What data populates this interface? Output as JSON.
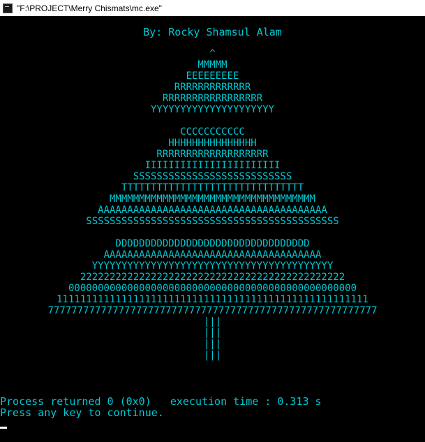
{
  "window": {
    "title": "\"F:\\PROJECT\\Merry Chismats\\mc.exe\""
  },
  "console": {
    "byline": "By: Rocky Shamsul Alam",
    "tree_lines": [
      "^",
      "MMMMM",
      "EEEEEEEEE",
      "RRRRRRRRRRRRR",
      "RRRRRRRRRRRRRRRRR",
      "YYYYYYYYYYYYYYYYYYYYY",
      "",
      "CCCCCCCCCCC",
      "HHHHHHHHHHHHHHH",
      "RRRRRRRRRRRRRRRRRRR",
      "IIIIIIIIIIIIIIIIIIIIIII",
      "SSSSSSSSSSSSSSSSSSSSSSSSSSS",
      "TTTTTTTTTTTTTTTTTTTTTTTTTTTTTTT",
      "MMMMMMMMMMMMMMMMMMMMMMMMMMMMMMMMMMM",
      "AAAAAAAAAAAAAAAAAAAAAAAAAAAAAAAAAAAAAAA",
      "SSSSSSSSSSSSSSSSSSSSSSSSSSSSSSSSSSSSSSSSSSS",
      "",
      "DDDDDDDDDDDDDDDDDDDDDDDDDDDDDDDDD",
      "AAAAAAAAAAAAAAAAAAAAAAAAAAAAAAAAAAAAA",
      "YYYYYYYYYYYYYYYYYYYYYYYYYYYYYYYYYYYYYYYYY",
      "222222222222222222222222222222222222222222222",
      "0000000000000000000000000000000000000000000000000",
      "11111111111111111111111111111111111111111111111111111",
      "77777777777777777777777777777777777777777777777777777777",
      "|||",
      "|||",
      "|||",
      "|||"
    ],
    "status_line": "Process returned 0 (0x0)   execution time : 0.313 s",
    "prompt_line": "Press any key to continue."
  },
  "colors": {
    "text": "#00c8d2",
    "background": "#000000"
  }
}
